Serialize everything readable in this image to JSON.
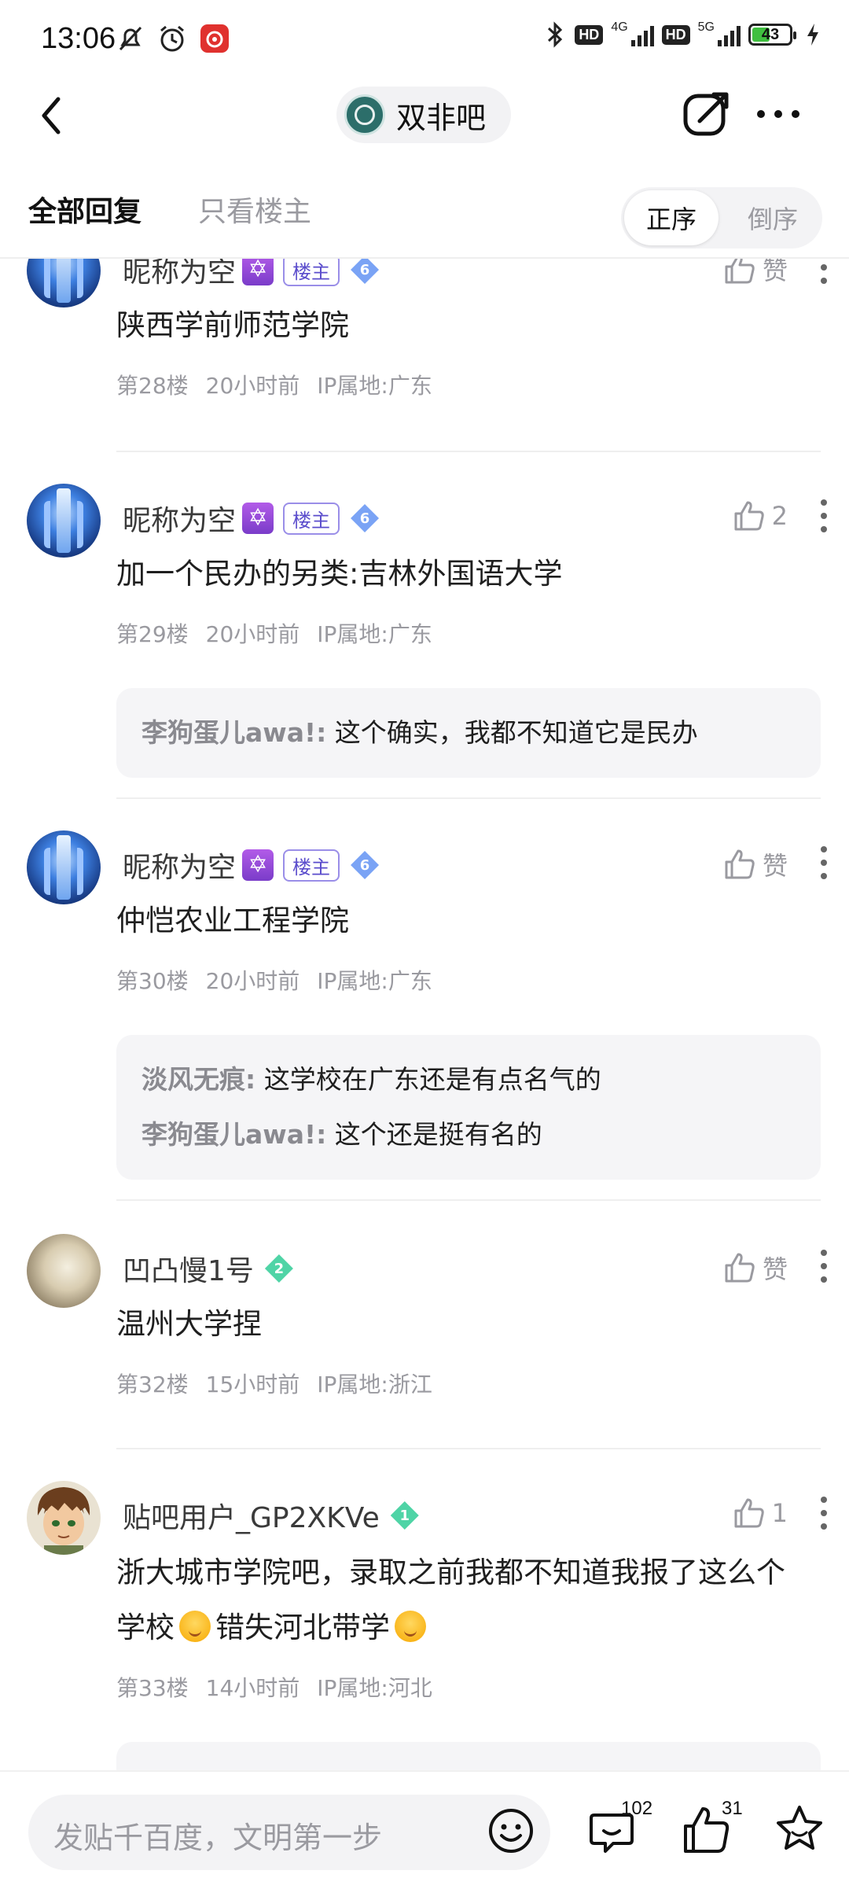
{
  "status_bar": {
    "time": "13:06",
    "net_1": "4G",
    "net_2": "5G",
    "hd": "HD",
    "battery": "43"
  },
  "header": {
    "forum_name": "双非吧"
  },
  "tabs": {
    "all_replies": "全部回复",
    "op_only": "只看楼主",
    "sort_asc": "正序",
    "sort_desc": "倒序"
  },
  "posts": [
    {
      "author": "昵称为空",
      "op_badge": "楼主",
      "level": "6",
      "likes": "赞",
      "content": "陕西学前师范学院",
      "floor": "第28楼",
      "time": "20小时前",
      "ip": "IP属地:广东"
    },
    {
      "author": "昵称为空",
      "op_badge": "楼主",
      "level": "6",
      "likes": "2",
      "content": "加一个民办的另类:吉林外国语大学",
      "floor": "第29楼",
      "time": "20小时前",
      "ip": "IP属地:广东",
      "replies": [
        {
          "author": "李狗蛋儿awa!:",
          "text": "这个确实，我都不知道它是民办"
        }
      ]
    },
    {
      "author": "昵称为空",
      "op_badge": "楼主",
      "level": "6",
      "likes": "赞",
      "content": "仲恺农业工程学院",
      "floor": "第30楼",
      "time": "20小时前",
      "ip": "IP属地:广东",
      "replies": [
        {
          "author": "淡风无痕:",
          "text": "这学校在广东还是有点名气的"
        },
        {
          "author": "李狗蛋儿awa!:",
          "text": "这个还是挺有名的"
        }
      ]
    },
    {
      "author": "凹凸慢1号",
      "level": "2",
      "likes": "赞",
      "content": "温州大学捏",
      "floor": "第32楼",
      "time": "15小时前",
      "ip": "IP属地:浙江"
    },
    {
      "author": "贴吧用户_GP2XKVe",
      "level": "1",
      "likes": "1",
      "content_line1": "浙大城市学院吧，录取之前我都不知道我报了这么个",
      "content_line2a": "学校",
      "content_line2b": "错失河北带学",
      "floor": "第33楼",
      "time": "14小时前",
      "ip": "IP属地:河北"
    }
  ],
  "bottom_bar": {
    "input_placeholder": "发贴千百度，文明第一步",
    "reply_count": "102",
    "like_count": "31"
  },
  "icons": {
    "accent_purple": "#7a3cc9",
    "level_blue": "#7aa3f5",
    "level_green": "#4fd4a6"
  }
}
